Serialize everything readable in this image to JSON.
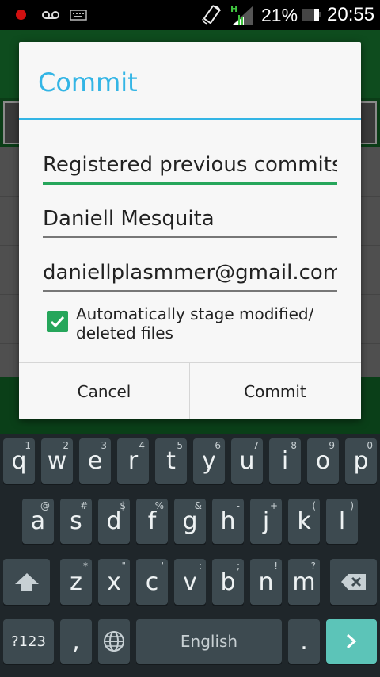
{
  "status_bar": {
    "battery_percent": "21%",
    "time": "20:55",
    "network_label": "H",
    "icons": [
      "recording-icon",
      "voicemail-icon",
      "keyboard-icon",
      "screen-rotation-icon",
      "signal-icon",
      "battery-icon"
    ]
  },
  "dialog": {
    "title": "Commit",
    "message_value": "Registered previous commits, u",
    "author_name_value": "Daniell Mesquita",
    "author_email_value": "daniellplasmmer@gmail.com",
    "auto_stage_checked": true,
    "auto_stage_label_line1": "Automatically stage modified/",
    "auto_stage_label_line2": "deleted files",
    "cancel_label": "Cancel",
    "commit_label": "Commit"
  },
  "keyboard": {
    "row1": [
      {
        "k": "q",
        "h": "1"
      },
      {
        "k": "w",
        "h": "2"
      },
      {
        "k": "e",
        "h": "3"
      },
      {
        "k": "r",
        "h": "4"
      },
      {
        "k": "t",
        "h": "5"
      },
      {
        "k": "y",
        "h": "6"
      },
      {
        "k": "u",
        "h": "7"
      },
      {
        "k": "i",
        "h": "8"
      },
      {
        "k": "o",
        "h": "9"
      },
      {
        "k": "p",
        "h": "0"
      }
    ],
    "row2": [
      {
        "k": "a",
        "h": "@"
      },
      {
        "k": "s",
        "h": "#"
      },
      {
        "k": "d",
        "h": "$"
      },
      {
        "k": "f",
        "h": "%"
      },
      {
        "k": "g",
        "h": "&"
      },
      {
        "k": "h",
        "h": "-"
      },
      {
        "k": "j",
        "h": "+"
      },
      {
        "k": "k",
        "h": "("
      },
      {
        "k": "l",
        "h": ")"
      }
    ],
    "row3": [
      {
        "k": "z",
        "h": "*"
      },
      {
        "k": "x",
        "h": "\""
      },
      {
        "k": "c",
        "h": "'"
      },
      {
        "k": "v",
        "h": ":"
      },
      {
        "k": "b",
        "h": ";"
      },
      {
        "k": "n",
        "h": "!"
      },
      {
        "k": "m",
        "h": "?"
      }
    ],
    "symbols_label": "?123",
    "comma": ",",
    "space_label": "English",
    "period": ".",
    "accent_color": "#5cc4b8"
  }
}
